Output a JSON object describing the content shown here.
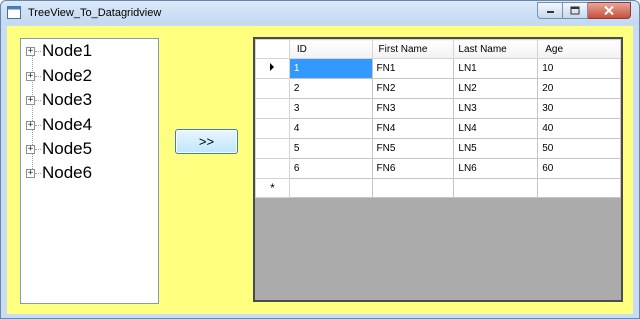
{
  "window": {
    "title": "TreeView_To_Datagridview",
    "controls": {
      "minimize_icon": "minimize-icon",
      "maximize_icon": "maximize-icon",
      "close_icon": "close-icon"
    }
  },
  "tree": {
    "expander_glyph": "+",
    "nodes": [
      "Node1",
      "Node2",
      "Node3",
      "Node4",
      "Node5",
      "Node6"
    ]
  },
  "transfer_button": {
    "label": ">>"
  },
  "grid": {
    "columns": [
      "ID",
      "First Name",
      "Last Name",
      "Age"
    ],
    "rows": [
      [
        "1",
        "FN1",
        "LN1",
        "10"
      ],
      [
        "2",
        "FN2",
        "LN2",
        "20"
      ],
      [
        "3",
        "FN3",
        "LN3",
        "30"
      ],
      [
        "4",
        "FN4",
        "LN4",
        "40"
      ],
      [
        "5",
        "FN5",
        "LN5",
        "50"
      ],
      [
        "6",
        "FN6",
        "LN6",
        "60"
      ]
    ],
    "new_row_marker": "*",
    "current_row_icon": "triangle-right-icon",
    "selection_color": "#3399ff"
  },
  "colors": {
    "form_background": "#ffff80",
    "grid_empty_area": "#ababab"
  }
}
